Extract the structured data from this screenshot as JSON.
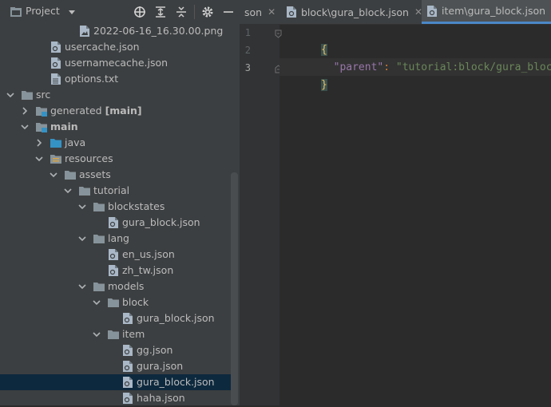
{
  "sidebar": {
    "title": "Project",
    "tree": [
      {
        "label": "2022-06-16_16.30.00.png",
        "depth": 5,
        "icon": "image-file-icon"
      },
      {
        "label": "usercache.json",
        "depth": 3,
        "icon": "json-file-icon"
      },
      {
        "label": "usernamecache.json",
        "depth": 3,
        "icon": "json-file-icon"
      },
      {
        "label": "options.txt",
        "depth": 3,
        "icon": "text-file-icon"
      },
      {
        "label": "src",
        "depth": 1,
        "icon": "folder-icon",
        "arrow": "down"
      },
      {
        "label": "generated",
        "bold": "[main]",
        "depth": 2,
        "icon": "module-folder-icon",
        "arrow": "right"
      },
      {
        "label": "main",
        "depth": 2,
        "icon": "module-folder-icon",
        "arrow": "down",
        "boldLabel": true
      },
      {
        "label": "java",
        "depth": 3,
        "icon": "source-folder-icon",
        "arrow": "right"
      },
      {
        "label": "resources",
        "depth": 3,
        "icon": "resources-folder-icon",
        "arrow": "down"
      },
      {
        "label": "assets",
        "depth": 4,
        "icon": "folder-icon",
        "arrow": "down"
      },
      {
        "label": "tutorial",
        "depth": 5,
        "icon": "folder-icon",
        "arrow": "down"
      },
      {
        "label": "blockstates",
        "depth": 6,
        "icon": "folder-icon",
        "arrow": "down"
      },
      {
        "label": "gura_block.json",
        "depth": 7,
        "icon": "json-file-icon"
      },
      {
        "label": "lang",
        "depth": 6,
        "icon": "folder-icon",
        "arrow": "down"
      },
      {
        "label": "en_us.json",
        "depth": 7,
        "icon": "json-file-icon"
      },
      {
        "label": "zh_tw.json",
        "depth": 7,
        "icon": "json-file-icon"
      },
      {
        "label": "models",
        "depth": 6,
        "icon": "folder-icon",
        "arrow": "down"
      },
      {
        "label": "block",
        "depth": 7,
        "icon": "folder-icon",
        "arrow": "down"
      },
      {
        "label": "gura_block.json",
        "depth": 8,
        "icon": "json-file-icon"
      },
      {
        "label": "item",
        "depth": 7,
        "icon": "folder-icon",
        "arrow": "down"
      },
      {
        "label": "gg.json",
        "depth": 8,
        "icon": "json-file-icon"
      },
      {
        "label": "gura.json",
        "depth": 8,
        "icon": "json-file-icon"
      },
      {
        "label": "gura_block.json",
        "depth": 8,
        "icon": "json-file-icon",
        "selected": true
      },
      {
        "label": "haha.json",
        "depth": 8,
        "icon": "json-file-icon"
      }
    ]
  },
  "tabs": [
    {
      "label": "son",
      "active": false
    },
    {
      "label": "block\\gura_block.json",
      "active": false
    },
    {
      "label": "item\\gura_block.json",
      "active": true
    }
  ],
  "editor": {
    "lines": [
      {
        "num": "1",
        "text": "{"
      },
      {
        "num": "2",
        "key": "\"parent\"",
        "sep": ": ",
        "value": "\"tutorial:block/gura_block\""
      },
      {
        "num": "3",
        "text": "}"
      }
    ]
  },
  "colors": {
    "key": "#9876aa",
    "string": "#6a8759",
    "brace": "#e8bf6a",
    "selection": "#0d293e",
    "folder": "#87939a"
  }
}
